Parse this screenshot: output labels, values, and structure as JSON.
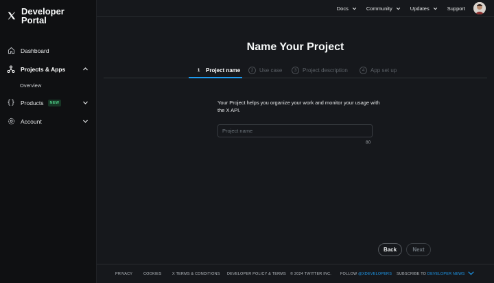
{
  "brand": {
    "line1": "Developer",
    "line2": "Portal"
  },
  "sidebar": {
    "dashboard": "Dashboard",
    "projects": "Projects & Apps",
    "overview": "Overview",
    "products": "Products",
    "products_badge": "NEW",
    "account": "Account"
  },
  "topnav": {
    "docs": "Docs",
    "community": "Community",
    "updates": "Updates",
    "support": "Support"
  },
  "main": {
    "title": "Name Your Project",
    "steps": [
      {
        "num": "1",
        "label": "Project name",
        "active": true
      },
      {
        "num": "2",
        "label": "Use case",
        "active": false
      },
      {
        "num": "3",
        "label": "Project description",
        "active": false
      },
      {
        "num": "4",
        "label": "App set up",
        "active": false
      }
    ],
    "description": "Your Project helps you organize your work and monitor your usage with the X API.",
    "input_placeholder": "Project name",
    "input_value": "",
    "char_counter": "80",
    "back_label": "Back",
    "next_label": "Next"
  },
  "footer": {
    "privacy": "PRIVACY",
    "cookies": "COOKIES",
    "terms": "X TERMS & CONDITIONS",
    "policy": "DEVELOPER POLICY & TERMS",
    "copyright": "© 2024 TWITTER INC.",
    "follow_prefix": "FOLLOW ",
    "follow_handle": "@XDEVELOPERS",
    "subscribe_prefix": "SUBSCRIBE TO ",
    "subscribe_link": "DEVELOPER NEWS"
  },
  "colors": {
    "accent": "#1d9bf0",
    "background": "#16181c",
    "sidebar": "#0f1012",
    "badge": "#4fd18a"
  },
  "icons": [
    "x-logo-icon",
    "home-icon",
    "projects-icon",
    "braces-icon",
    "gear-icon",
    "chevron-down-icon",
    "chevron-up-icon"
  ]
}
